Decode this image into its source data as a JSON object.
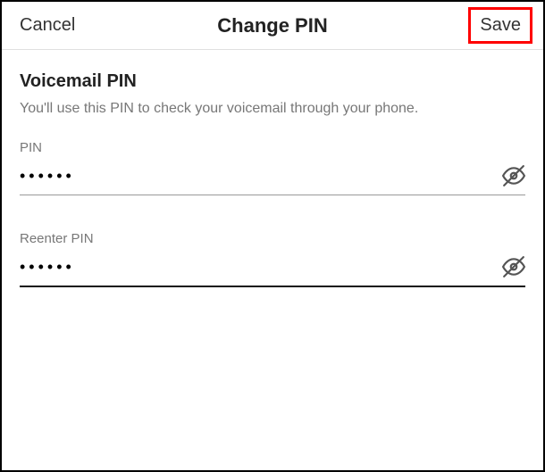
{
  "header": {
    "cancel_label": "Cancel",
    "title": "Change PIN",
    "save_label": "Save"
  },
  "content": {
    "section_title": "Voicemail PIN",
    "description": "You'll use this PIN to check your voicemail through your phone.",
    "pin_field": {
      "label": "PIN",
      "value": "••••••"
    },
    "reenter_field": {
      "label": "Reenter PIN",
      "value": "••••••"
    }
  }
}
